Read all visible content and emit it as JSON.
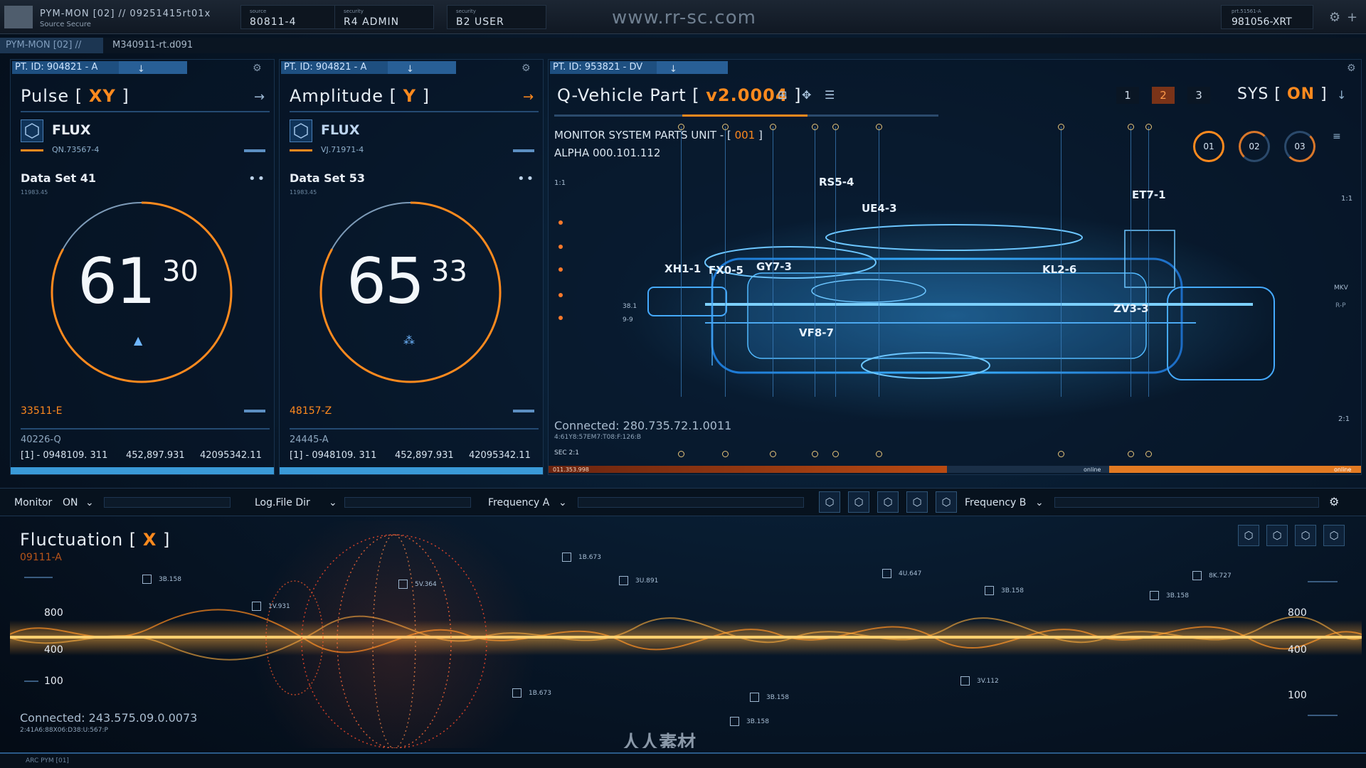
{
  "topbar": {
    "title": "PYM-MON [02] // 09251415rt01x",
    "subtitle": "Source Secure",
    "cells": [
      {
        "label": "source",
        "value": "80811-4"
      },
      {
        "label": "security",
        "value": "R4 ADMIN"
      },
      {
        "label": "security",
        "value": "B2 USER"
      }
    ],
    "watermark": "www.rr-sc.com",
    "right_label": "prt.51561-A",
    "right_value": "981056-XRT"
  },
  "pathbar": {
    "active": "PYM-MON [02] //",
    "path": "M340911-rt.d091"
  },
  "pulse": {
    "tab": "PT. ID: 904821 - A",
    "title_pre": "Pulse [ ",
    "title_hl": "XY",
    "title_post": " ]",
    "flux": "FLUX",
    "code": "QN.73567-4",
    "dataset": "Data Set 41",
    "ds_sub": "11983.45",
    "main": "61",
    "sup": "30",
    "footer_code": "33511-E",
    "footer2": "40226-Q",
    "row": [
      "[1]  -  0948109. 311",
      "452,897.931",
      "42095342.11"
    ],
    "gauge": 0.83
  },
  "amplitude": {
    "tab": "PT. ID: 904821 - A",
    "title_pre": "Amplitude [ ",
    "title_hl": "Y",
    "title_post": " ]",
    "flux": "FLUX",
    "code": "VJ.71971-4",
    "dataset": "Data Set 53",
    "ds_sub": "11983.45",
    "main": "65",
    "sup": "33",
    "footer_code": "48157-Z",
    "footer2": "24445-A",
    "row": [
      "[1]  -  0948109. 311",
      "452,897.931",
      "42095342.11"
    ],
    "gauge": 0.83
  },
  "vehicle": {
    "tab": "PT. ID: 953821 - DV",
    "title_pre": "Q-Vehicle Part [ ",
    "title_hl": "v2.0004",
    "title_post": " ]",
    "pages": [
      "1",
      "2",
      "3"
    ],
    "sys_pre": "SYS [ ",
    "sys_hl": "ON",
    "sys_post": " ]",
    "monitor_pre": "MONITOR SYSTEM PARTS UNIT - [ ",
    "monitor_hl": "001",
    "monitor_post": " ]",
    "alpha": "ALPHA 000.101.112",
    "ratio_left": "1:1",
    "ratio_right": "1:1",
    "ratio_r2": "2:1",
    "mkv": "MKV",
    "rp": "R-P",
    "rings": [
      "01",
      "02",
      "03"
    ],
    "labels": [
      "RS5-4",
      "UE4-3",
      "ET7-1",
      "XH1-1",
      "FX0-5",
      "GY7-3",
      "KL2-6",
      "ZV3-3",
      "VF8-7"
    ],
    "left_small": [
      "38.1",
      "9-9"
    ],
    "connected": "Connected: 280.735.72.1.0011",
    "conn_sub": "4:61Y8:57EM7:T08:F:126:B",
    "sec": "SEC 2:1",
    "bar_left": "011.353.998",
    "bar_mid": "online",
    "bar_right": "online"
  },
  "controls": {
    "monitor": "Monitor",
    "monitor_val": "ON",
    "log": "Log.File Dir",
    "freqA": "Frequency A",
    "freqB": "Frequency B"
  },
  "fluct": {
    "title_pre": "Fluctuation [ ",
    "title_hl": "X",
    "title_post": " ]",
    "code": "09111-A",
    "y_left": [
      "800",
      "400",
      "100"
    ],
    "y_right": [
      "800",
      "400",
      "100"
    ],
    "markers": [
      "3B.158",
      "1V.931",
      "5V.364",
      "1B.673",
      "3U.891",
      "4U.647",
      "3B.158",
      "8K.727",
      "3B.158",
      "3V.112",
      "1B.673",
      "3B.158",
      "3B.158"
    ],
    "connected": "Connected: 243.575.09.0.0073",
    "conn_sub": "2:41A6:88X06:D38:U:567:P"
  },
  "footer": {
    "text": "ARC PYM [01]",
    "brand": "人人素材"
  },
  "colors": {
    "accent": "#ff8a1e",
    "blue": "#3a9ad8"
  }
}
